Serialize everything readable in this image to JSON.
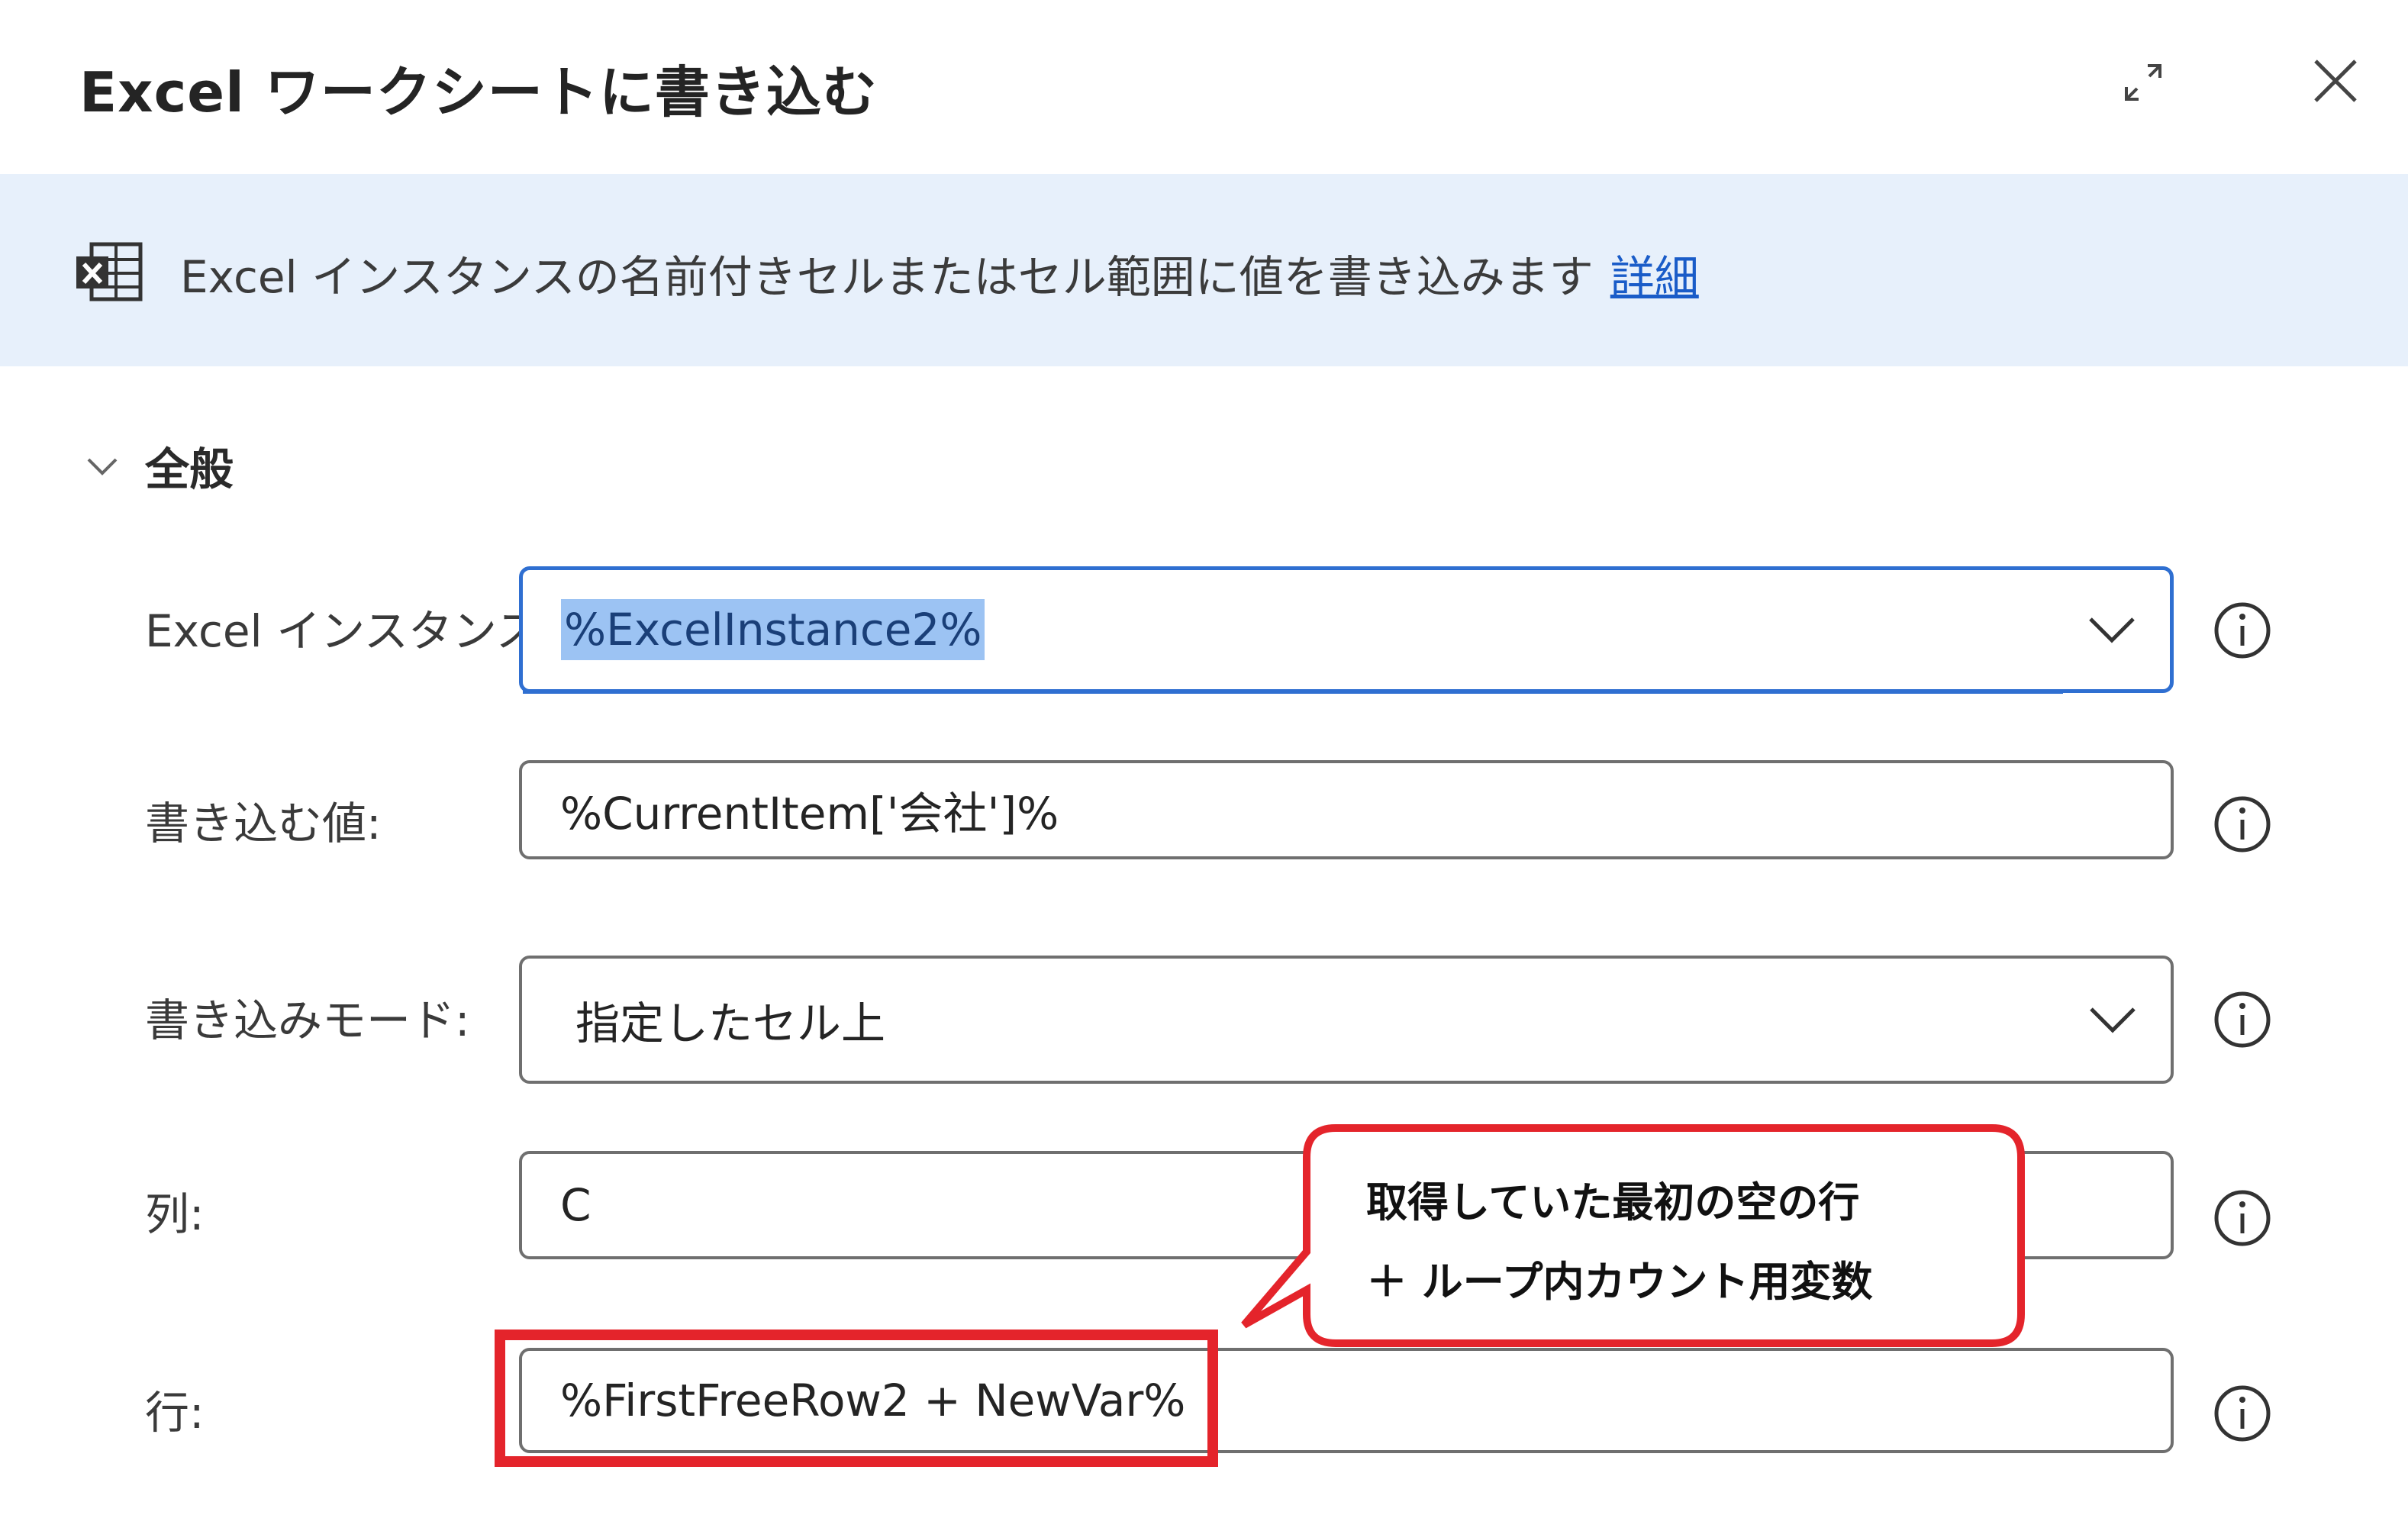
{
  "dialog": {
    "title": "Excel ワークシートに書き込む",
    "expand_icon": "expand-icon",
    "close_icon": "close-icon"
  },
  "banner": {
    "icon": "excel-icon",
    "description": "Excel インスタンスの名前付きセルまたはセル範囲に値を書き込みます",
    "link_text": "詳細",
    "background": "#e7f0fb",
    "link_color": "#1a5cc8"
  },
  "section": {
    "label": "全般",
    "icon": "chevron-down-icon"
  },
  "fields": {
    "excel_instance": {
      "label": "Excel インスタンス:",
      "value": "%ExcelInstance2%"
    },
    "write_value": {
      "label": "書き込む値:",
      "value": "%CurrentItem['会社']%"
    },
    "write_mode": {
      "label": "書き込みモード:",
      "value": "指定したセル上"
    },
    "column": {
      "label": "列:",
      "value": "C"
    },
    "row": {
      "label": "行:",
      "value": "%FirstFreeRow2 + NewVar%"
    }
  },
  "annotation": {
    "line1": "取得していた最初の空の行",
    "line2": "＋ ループ内カウント用変数",
    "color": "#e4242b"
  },
  "accent_color": "#2f6fd1"
}
